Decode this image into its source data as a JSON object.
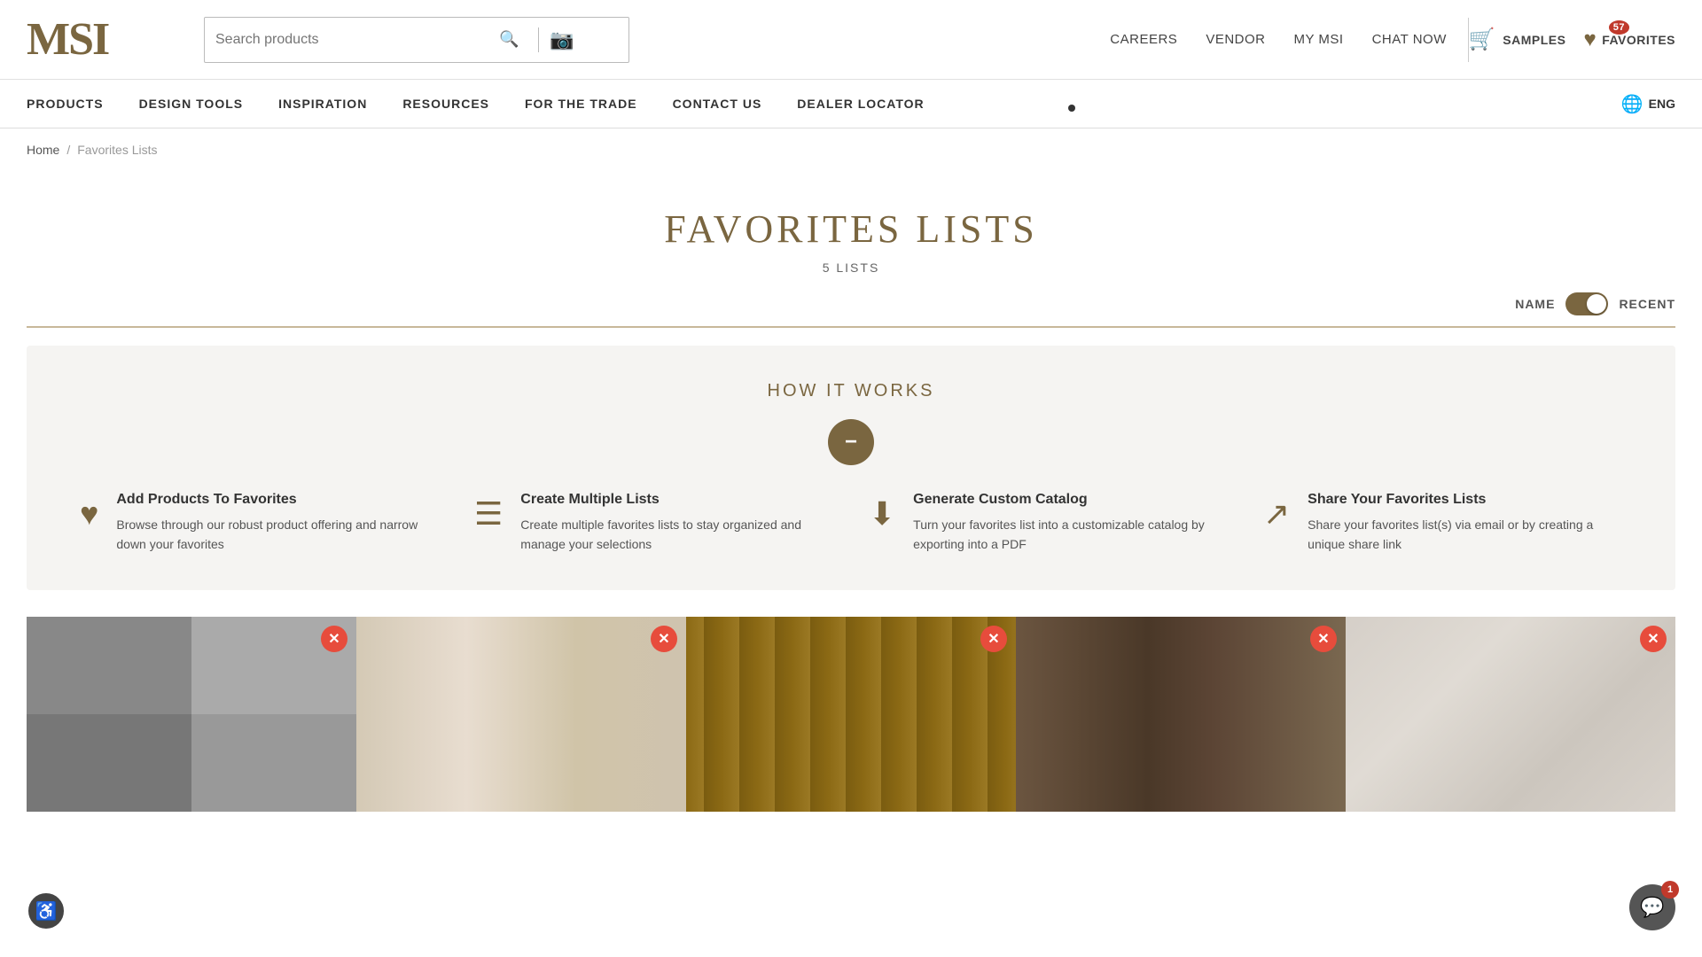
{
  "logo": {
    "text": "MSI"
  },
  "header": {
    "search": {
      "placeholder": "Search products"
    },
    "nav": [
      {
        "label": "CAREERS",
        "href": "#"
      },
      {
        "label": "VENDOR",
        "href": "#"
      },
      {
        "label": "MY MSI",
        "href": "#"
      },
      {
        "label": "CHAT NOW",
        "href": "#"
      }
    ],
    "samples_label": "SAMPLES",
    "favorites_label": "FAVORITES",
    "favorites_count": "57",
    "lang": "ENG"
  },
  "main_nav": [
    {
      "label": "PRODUCTS"
    },
    {
      "label": "DESIGN TOOLS"
    },
    {
      "label": "INSPIRATION"
    },
    {
      "label": "RESOURCES"
    },
    {
      "label": "FOR THE TRADE"
    },
    {
      "label": "CONTACT US"
    },
    {
      "label": "DEALER LOCATOR"
    }
  ],
  "breadcrumb": {
    "home": "Home",
    "separator": "/",
    "current": "Favorites Lists"
  },
  "page": {
    "title": "FAVORITES LISTS",
    "count": "5 LISTS"
  },
  "sort": {
    "name_label": "NAME",
    "recent_label": "RECENT"
  },
  "how_it_works": {
    "title": "HOW IT WORKS",
    "collapse_icon": "−",
    "features": [
      {
        "icon": "♥",
        "title": "Add Products To Favorites",
        "desc": "Browse through our robust product offering and narrow down your favorites"
      },
      {
        "icon": "☰",
        "title": "Create Multiple Lists",
        "desc": "Create multiple favorites lists to stay organized and manage your selections"
      },
      {
        "icon": "⬇",
        "title": "Generate Custom Catalog",
        "desc": "Turn your favorites list into a customizable catalog by exporting into a PDF"
      },
      {
        "icon": "↗",
        "title": "Share Your Favorites Lists",
        "desc": "Share your favorites list(s) via email or by creating a unique share link"
      }
    ]
  },
  "cards": [
    {
      "type": "gray-tile",
      "close": "×"
    },
    {
      "type": "light-stone",
      "close": "×"
    },
    {
      "type": "wood",
      "close": "×"
    },
    {
      "type": "dark-tile",
      "close": "×"
    },
    {
      "type": "light-concrete",
      "close": "×"
    }
  ],
  "accessibility": {
    "icon": "♿"
  },
  "chat": {
    "icon": "💬",
    "badge": "1"
  }
}
